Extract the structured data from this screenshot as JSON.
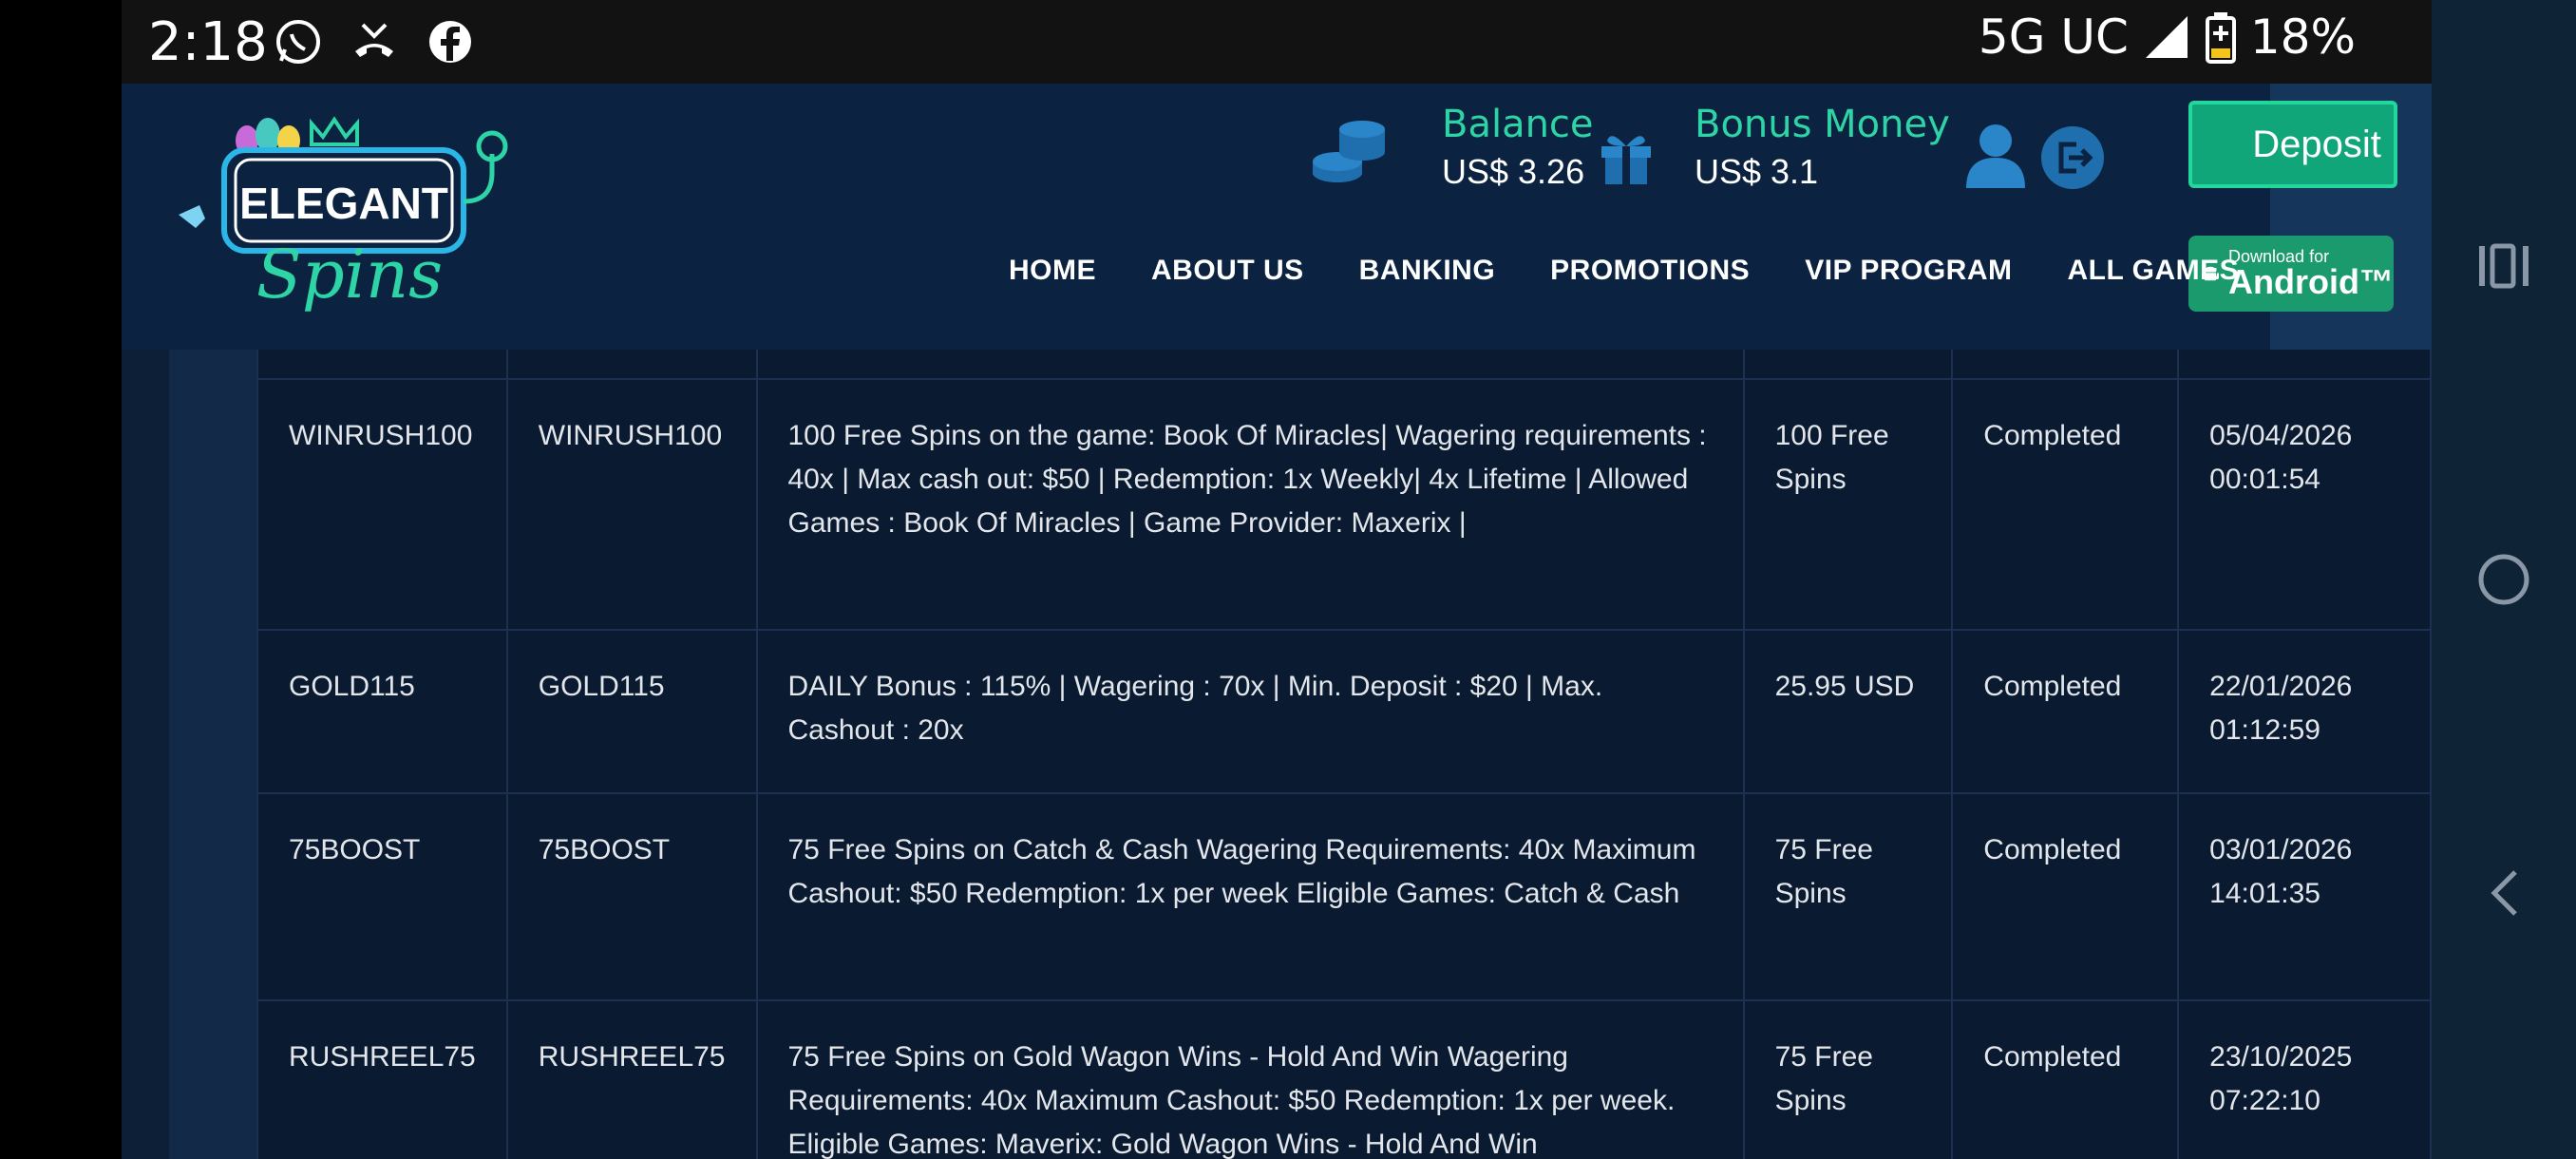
{
  "statusbar": {
    "time": "2:18",
    "network": "5G UC",
    "battery": "18%"
  },
  "header": {
    "logo_text_top": "ELEGANT",
    "logo_text_bottom": "Spins",
    "balance_label": "Balance",
    "balance_value": "US$ 3.26",
    "bonus_label": "Bonus Money",
    "bonus_value": "US$ 3.1",
    "deposit_label": "Deposit",
    "android_small": "Download for",
    "android_big": "Android™",
    "menu": [
      "HOME",
      "ABOUT US",
      "BANKING",
      "PROMOTIONS",
      "VIP PROGRAM",
      "ALL GAMES"
    ]
  },
  "bonus_table": {
    "rows": [
      {
        "code": "WINRUSH100",
        "name": "WINRUSH100",
        "description": "100 Free Spins on the game: Book Of Miracles| Wagering requirements : 40x | Max cash out: $50 | Redemption: 1x Weekly| 4x Lifetime | Allowed Games : Book Of Miracles | Game Provider: Maxerix |",
        "amount": "100 Free Spins",
        "status": "Completed",
        "date": "05/04/2026",
        "time": "00:01:54"
      },
      {
        "code": "GOLD115",
        "name": "GOLD115",
        "description": "DAILY Bonus : 115% | Wagering : 70x | Min. Deposit : $20 | Max. Cashout : 20x",
        "amount": "25.95 USD",
        "status": "Completed",
        "date": "22/01/2026",
        "time": "01:12:59"
      },
      {
        "code": "75BOOST",
        "name": "75BOOST",
        "description": "75 Free Spins on Catch & Cash Wagering Requirements: 40x Maximum Cashout: $50 Redemption: 1x per week Eligible Games: Catch & Cash",
        "amount": "75 Free Spins",
        "status": "Completed",
        "date": "03/01/2026",
        "time": "14:01:35"
      },
      {
        "code": "RUSHREEL75",
        "name": "RUSHREEL75",
        "description": "75 Free Spins on Gold Wagon Wins - Hold And Win Wagering Requirements: 40x Maximum Cashout: $50 Redemption: 1x per week. Eligible Games: Maverix: Gold Wagon Wins - Hold And Win",
        "amount": "75 Free Spins",
        "status": "Completed",
        "date": "23/10/2025",
        "time": "07:22:10"
      }
    ]
  }
}
